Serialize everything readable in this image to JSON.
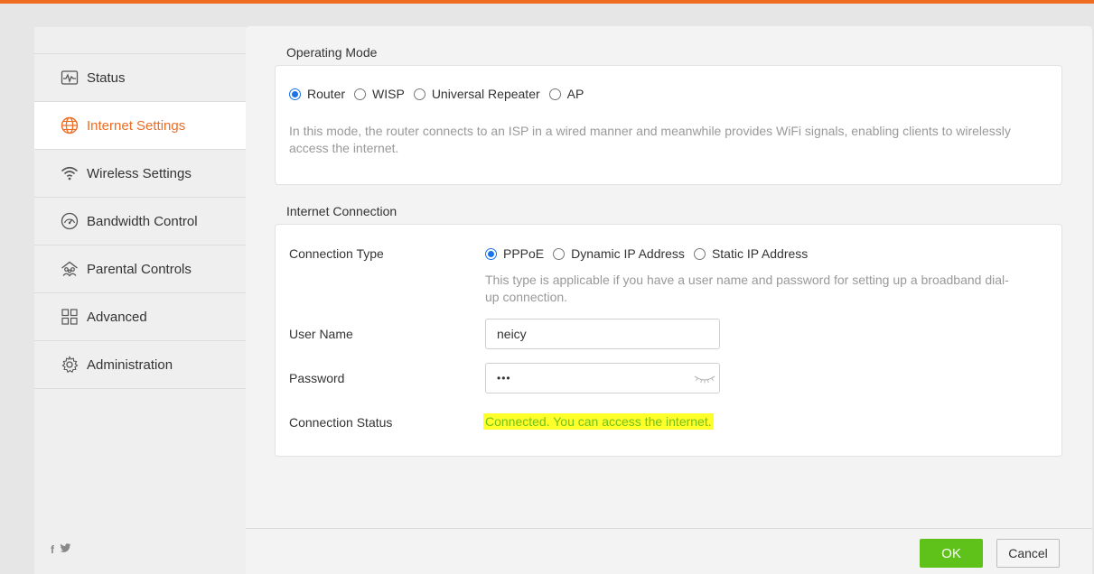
{
  "colors": {
    "accent": "#ef6c23",
    "radio": "#1a73e8",
    "ok_button": "#5fc21a",
    "status_text": "#71c21a",
    "highlight": "#ffff2a"
  },
  "sidebar": {
    "items": [
      {
        "label": "Status",
        "icon": "status-monitor-icon"
      },
      {
        "label": "Internet Settings",
        "icon": "globe-icon",
        "active": true
      },
      {
        "label": "Wireless Settings",
        "icon": "wifi-icon"
      },
      {
        "label": "Bandwidth Control",
        "icon": "gauge-icon"
      },
      {
        "label": "Parental Controls",
        "icon": "parental-controls-icon"
      },
      {
        "label": "Advanced",
        "icon": "grid-icon"
      },
      {
        "label": "Administration",
        "icon": "gear-icon"
      }
    ],
    "social": [
      "f",
      "twitter-icon"
    ]
  },
  "operating_mode": {
    "title": "Operating Mode",
    "options": [
      "Router",
      "WISP",
      "Universal Repeater",
      "AP"
    ],
    "selected": "Router",
    "description": "In this mode, the router connects to an ISP in a wired manner and meanwhile provides WiFi signals, enabling clients to wirelessly access the internet."
  },
  "internet_connection": {
    "title": "Internet Connection",
    "connection_type_label": "Connection Type",
    "types": [
      "PPPoE",
      "Dynamic IP Address",
      "Static IP Address"
    ],
    "selected_type": "PPPoE",
    "type_description": "This type is applicable if you have a user name and password for setting up a broadband dial-up connection.",
    "username_label": "User Name",
    "username_value": "neicy",
    "password_label": "Password",
    "password_value": "•••",
    "status_label": "Connection Status",
    "status_value": "Connected. You can access the internet."
  },
  "footer": {
    "ok_label": "OK",
    "cancel_label": "Cancel"
  }
}
